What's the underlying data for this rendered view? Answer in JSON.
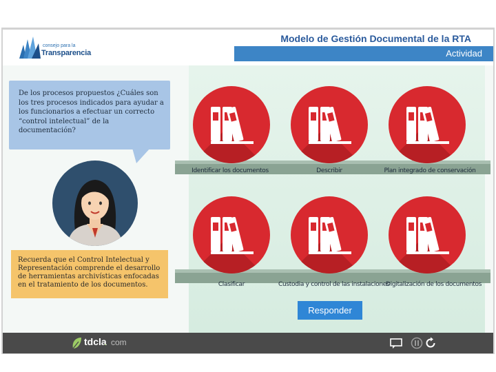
{
  "header": {
    "logo_small": "consejo para la",
    "logo_big": "Transparencia",
    "title": "Modelo de Gestión Documental de la RTA",
    "subtitle": "Actividad"
  },
  "question": "De los procesos propuestos ¿Cuáles son los tres procesos indicados para ayudar a los funcionarios a efectuar un correcto “control intelectual” de la documentación?",
  "hint": "Recuerda que el Control Intelectual y Representación comprende el desarrollo de herramientas archivísticas enfocadas en el tratamiento de los documentos.",
  "options": [
    {
      "label": "Identificar los documentos"
    },
    {
      "label": "Describir"
    },
    {
      "label": "Plan integrado de conservación"
    },
    {
      "label": "Clasificar"
    },
    {
      "label": "Custodia y control de las instalaciones"
    },
    {
      "label": "Digitalización de los documentos"
    }
  ],
  "respond_label": "Responder",
  "footer": {
    "brand": "tdcla",
    "dot": ".",
    "com": "com"
  },
  "icons": {
    "item_icon": "binders-icon",
    "footer_icons": [
      "comment-icon",
      "pause-icon",
      "replay-icon"
    ]
  },
  "colors": {
    "accent": "#3d85c6",
    "option_red": "#d8292f",
    "hint_bg": "#f5c46b",
    "bubble_bg": "#a8c5e6",
    "footer_bg": "#4a4a4a",
    "button_blue": "#2f86d6"
  }
}
